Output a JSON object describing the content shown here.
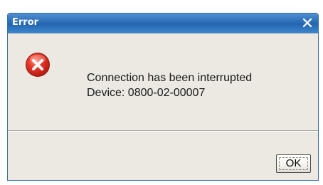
{
  "dialog": {
    "title": "Error",
    "icon": "error-icon",
    "close_icon": "close-icon",
    "message_line1": "Connection has been interrupted",
    "message_line2": "Device: 0800-02-00007",
    "ok_label": "OK"
  },
  "colors": {
    "titlebar": "#2a6cb6",
    "body": "#ece9e2",
    "error_red": "#d9261c"
  }
}
